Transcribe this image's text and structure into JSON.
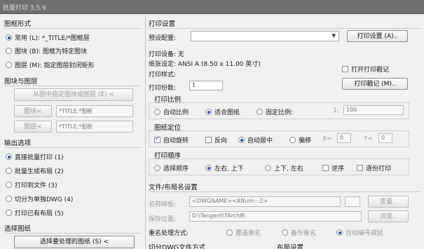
{
  "window": {
    "title": "批量打印 3.5.9"
  },
  "left": {
    "style_section": "图框形式",
    "style_options": [
      {
        "label": "常用 (L): *_TITLE/*图框层",
        "selected": true
      },
      {
        "label": "图块 (B): 图框为特定图块",
        "selected": false
      },
      {
        "label": "图层 (M): 指定图层封闭矩形",
        "selected": false
      }
    ],
    "blocks_section": "图块与图层",
    "pick_button": "从图中指定图块或图层 (E) <",
    "block_button": "图块<",
    "block_value": "*TITLE,*图框",
    "layer_button": "图层<",
    "layer_value": "*TITLE,*图框",
    "output_section": "输出选项",
    "output_options": [
      {
        "label": "直接批量打印 (1)",
        "selected": true
      },
      {
        "label": "批量生成布局 (2)",
        "selected": false
      },
      {
        "label": "打印到文件 (3)",
        "selected": false
      },
      {
        "label": "切分为单独DWG (4)",
        "selected": false
      },
      {
        "label": "打印已有布局 (5)",
        "selected": false
      }
    ],
    "select_section": "选择图纸",
    "select_button": "选择要处理的图纸 (S) <"
  },
  "right": {
    "print_section": "打印设置",
    "preset_label": "预设配置:",
    "preset_value": "",
    "print_settings_button": "打印设置 (A)..",
    "device_label": "打印设备: 无",
    "paper_label": "纸张设定: ANSI A (8.50 x 11.00 英寸)",
    "style_label": "打印样式:",
    "open_stamp_label": "打开打印戳记",
    "copies_label": "打印份数:",
    "copies_value": "1",
    "stamp_button": "打印戳记 (M)..",
    "scale_section": "打印比例",
    "scale_auto": "自动比例",
    "scale_fit": "适合图纸",
    "scale_fixed": "固定比例:",
    "scale_prefix": "1:",
    "scale_value": "100",
    "position_section": "图纸定位",
    "auto_rotate": "自动旋转",
    "reverse": "反向",
    "auto_center": "自动居中",
    "offset": "偏移",
    "x_label": "X=",
    "x_value": "0",
    "y_label": "Y=",
    "y_value": "0",
    "order_section": "打印顺序",
    "order_select": "选择顺序",
    "order_lr": "左右, 上下",
    "order_tb": "上下, 左右",
    "order_reverse": "逆序",
    "order_collate": "逐份打印",
    "file_section": "文件/布局名设置",
    "name_label": "名称样板:",
    "name_value": "<DWGNAME><ANum:-:2>",
    "variable_button": "变量..",
    "save_label": "保存位置:",
    "save_value": "D:\\Tangent\\TArch8\\",
    "browse_button": "浏览..",
    "dup_label": "重名处理方式:",
    "dup_overwrite": "覆盖重名",
    "dup_backup": "备份重名",
    "dup_auto": "自动编号顺延",
    "split_section": "切分DWG文件方式",
    "layout_section": "布局设置"
  }
}
